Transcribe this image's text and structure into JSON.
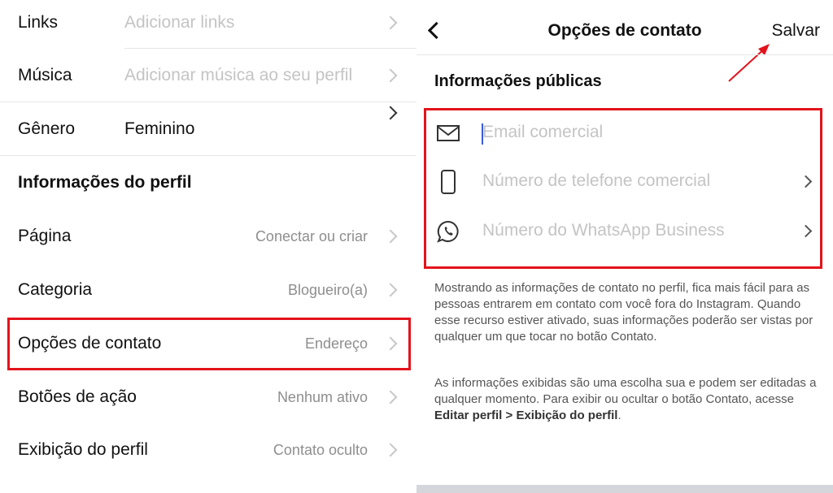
{
  "left": {
    "rows": [
      {
        "label": "Links",
        "value": "Adicionar links"
      },
      {
        "label": "Música",
        "value": "Adicionar música ao seu perfil"
      },
      {
        "label": "Gênero",
        "value": "Feminino"
      }
    ],
    "section_title": "Informações do perfil",
    "profile_rows": [
      {
        "label": "Página",
        "value": "Conectar ou criar"
      },
      {
        "label": "Categoria",
        "value": "Blogueiro(a)"
      },
      {
        "label": "Opções de contato",
        "value": "Endereço"
      },
      {
        "label": "Botões de ação",
        "value": "Nenhum ativo"
      },
      {
        "label": "Exibição do perfil",
        "value": "Contato oculto"
      }
    ]
  },
  "right": {
    "title": "Opções de contato",
    "save_label": "Salvar",
    "section_title": "Informações públicas",
    "fields": {
      "email_placeholder": "Email comercial",
      "phone_placeholder": "Número de telefone comercial",
      "whatsapp_placeholder": "Número do WhatsApp Business"
    },
    "description1": "Mostrando as informações de contato no perfil, fica mais fácil para as pessoas entrarem em contato com você fora do Instagram. Quando esse recurso estiver ativado, suas informações poderão ser vistas por qualquer um que tocar no botão Contato.",
    "description2_prefix": "As informações exibidas são uma escolha sua e podem ser editadas a qualquer momento. Para exibir ou ocultar o botão Contato, acesse ",
    "description2_bold": "Editar perfil > Exibição do perfil",
    "description2_suffix": "."
  },
  "colors": {
    "highlight": "#e3131b",
    "placeholder": "#c4c4c4",
    "secondary_text": "#8e8e8e"
  }
}
